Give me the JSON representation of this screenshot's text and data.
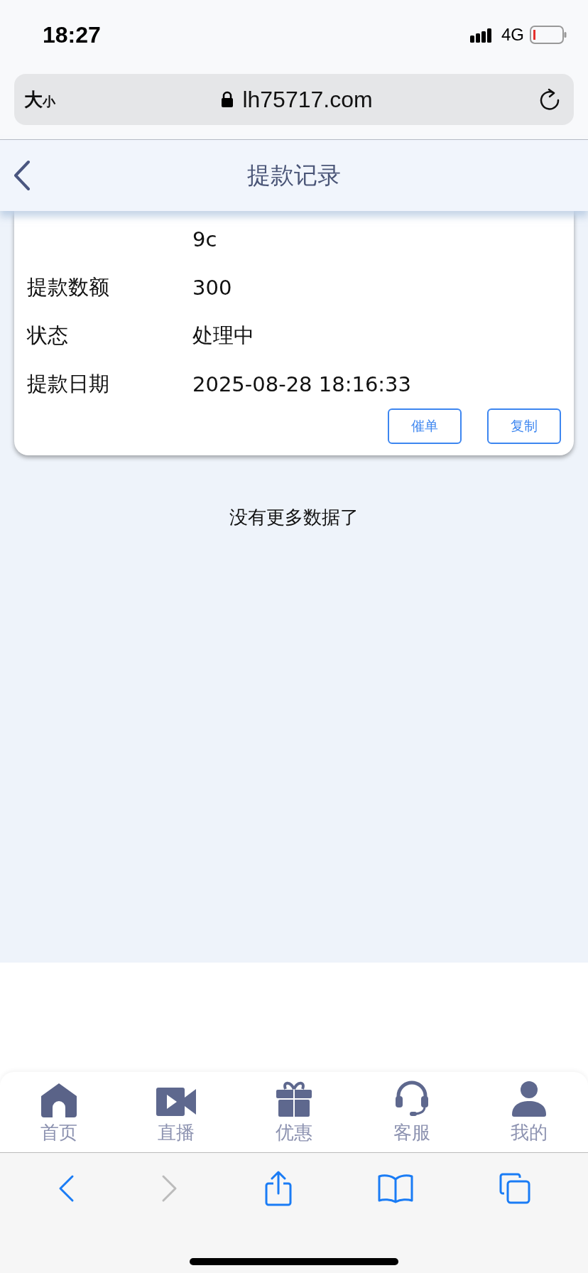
{
  "status_bar": {
    "time": "18:27",
    "network": "4G"
  },
  "address_bar": {
    "text_size": "大",
    "text_size_small": "小",
    "url": "lh75717.com"
  },
  "header": {
    "title": "提款记录"
  },
  "record": {
    "rows": [
      {
        "label": "",
        "value": "9c"
      },
      {
        "label": "提款数额",
        "value": "300"
      },
      {
        "label": "状态",
        "value": "处理中"
      },
      {
        "label": "提款日期",
        "value": "2025-08-28 18:16:33"
      }
    ],
    "buttons": [
      "催单",
      "复制"
    ]
  },
  "end_message": "没有更多数据了",
  "tab_bar": [
    {
      "label": "首页",
      "kind": "home"
    },
    {
      "label": "直播",
      "kind": "live"
    },
    {
      "label": "优惠",
      "kind": "gift"
    },
    {
      "label": "客服",
      "kind": "support"
    },
    {
      "label": "我的",
      "kind": "profile"
    }
  ],
  "browser_toolbar": {
    "back_disabled": false,
    "forward_disabled": true
  }
}
